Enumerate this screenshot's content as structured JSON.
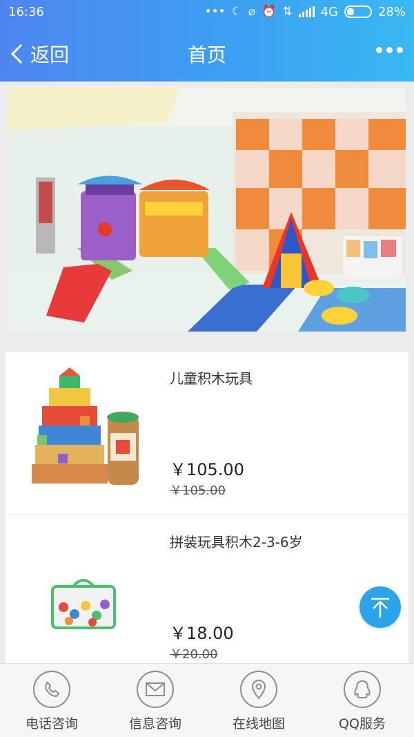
{
  "status_bar": {
    "time": "16:36",
    "network": "4G",
    "battery": "28%"
  },
  "navbar": {
    "back_label": "返回",
    "title": "首页"
  },
  "products": [
    {
      "name": "儿童积木玩具",
      "price": "￥105.00",
      "original_price": "￥105.00"
    },
    {
      "name": "拼装玩具积木2-3-6岁",
      "price": "￥18.00",
      "original_price": "￥20.00"
    }
  ],
  "bottom_nav": [
    {
      "label": "电话咨询",
      "icon": "phone-icon"
    },
    {
      "label": "信息咨询",
      "icon": "mail-icon"
    },
    {
      "label": "在线地图",
      "icon": "location-pin-icon"
    },
    {
      "label": "QQ服务",
      "icon": "qq-penguin-icon"
    }
  ],
  "colors": {
    "header_start": "#4e86f0",
    "header_end": "#39b8f2",
    "to_top_button": "#2ba4ea"
  }
}
